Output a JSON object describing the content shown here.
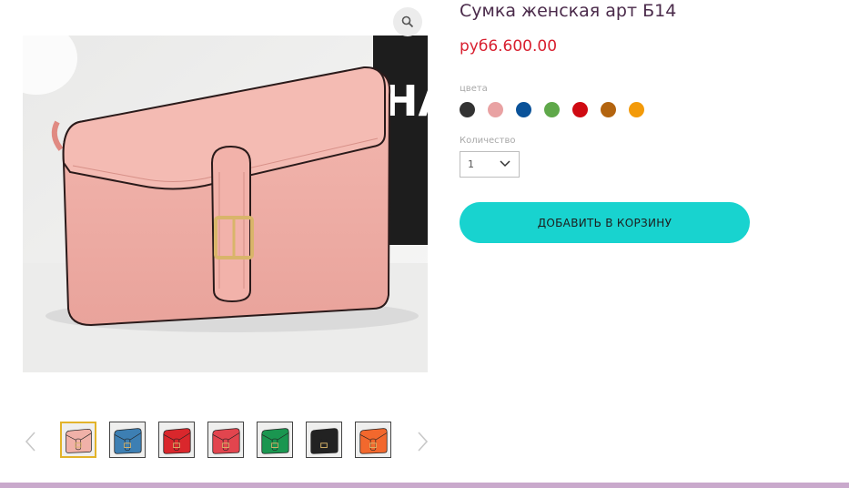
{
  "product": {
    "title": "Сумка женская арт Б14",
    "price": "руб6.600.00",
    "main_color": "#f0aaa4"
  },
  "colors": {
    "label": "цвета",
    "swatches": [
      {
        "name": "black",
        "hex": "#333333"
      },
      {
        "name": "pink",
        "hex": "#e9a2a3"
      },
      {
        "name": "blue",
        "hex": "#0a5299"
      },
      {
        "name": "green",
        "hex": "#5fa84a"
      },
      {
        "name": "red",
        "hex": "#cf0a12"
      },
      {
        "name": "brown",
        "hex": "#b3640f"
      },
      {
        "name": "orange",
        "hex": "#f39a09"
      }
    ]
  },
  "quantity": {
    "label": "Количество",
    "value": "1"
  },
  "cart": {
    "add_label": "ДОБАВИТЬ В КОРЗИНУ"
  },
  "thumbnails": [
    {
      "color": "pink",
      "hex": "#f0b1a8",
      "active": true
    },
    {
      "color": "blue",
      "hex": "#3d7fb3",
      "active": false
    },
    {
      "color": "red",
      "hex": "#d9272c",
      "active": false
    },
    {
      "color": "coral",
      "hex": "#e2454e",
      "active": false
    },
    {
      "color": "green",
      "hex": "#1a9650",
      "active": false
    },
    {
      "color": "black",
      "hex": "#222222",
      "active": false
    },
    {
      "color": "orange",
      "hex": "#f2682d",
      "active": false
    }
  ],
  "accent_colors": {
    "price": "#d81f2f",
    "button": "#18d3cf",
    "bottom_bar": "#c9a9cc",
    "active_thumb_border": "#e2b32a"
  }
}
